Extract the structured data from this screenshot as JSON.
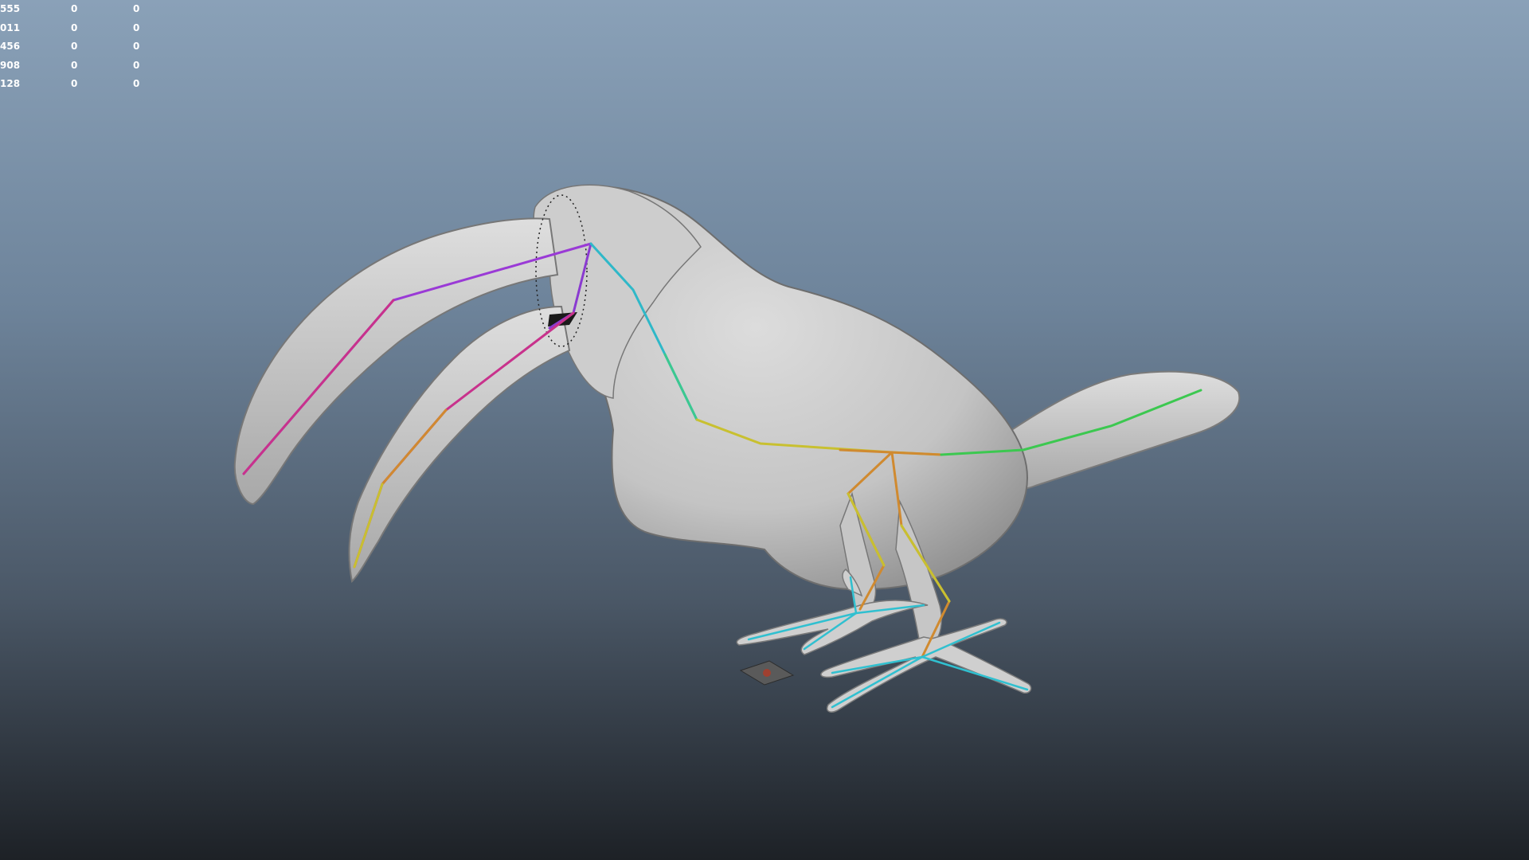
{
  "hud": {
    "rows": [
      [
        "555",
        "0",
        "0"
      ],
      [
        "011",
        "0",
        "0"
      ],
      [
        "456",
        "0",
        "0"
      ],
      [
        "908",
        "0",
        "0"
      ],
      [
        "128",
        "0",
        "0"
      ]
    ]
  },
  "colors": {
    "viewport_top": "#8aa1b8",
    "viewport_bottom": "#1d2126",
    "mesh": "#c8c8c8",
    "mesh_shadow": "#8a8a8a",
    "joint_beak_upper": "#9a3ad6",
    "joint_beak_lower": "#c8328c",
    "joint_neck": "#2fb8c8",
    "joint_spine": "#c8c030",
    "joint_tail": "#3cc850",
    "joint_leg": "#d08a30",
    "joint_foot": "#30c0d0",
    "manipulator": "#5a5a5a",
    "manipulator_accent": "#a04030"
  },
  "icons": {
    "pivot": "pivot-manipulator-icon"
  }
}
